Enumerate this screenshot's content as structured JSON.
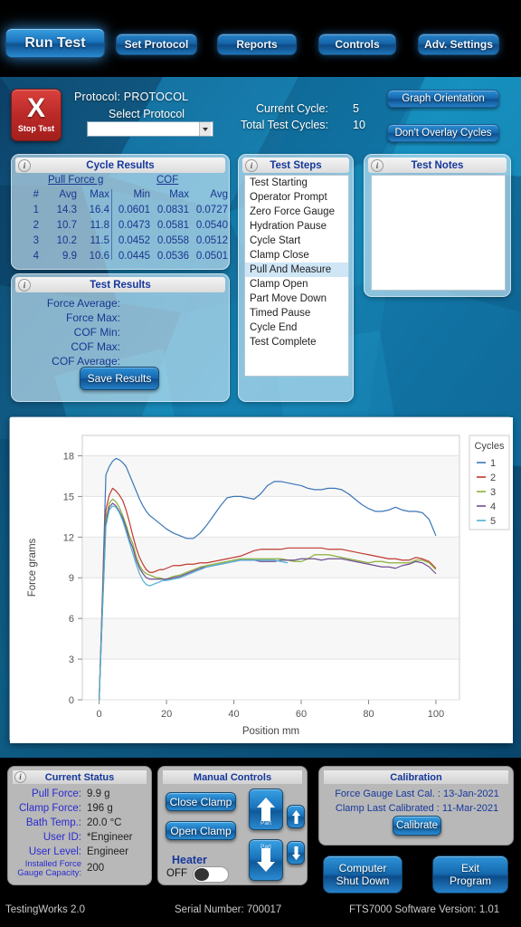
{
  "topnav": {
    "items": [
      {
        "label": "Run Test",
        "active": true
      },
      {
        "label": "Set Protocol",
        "active": false
      },
      {
        "label": "Reports",
        "active": false
      },
      {
        "label": "Controls",
        "active": false
      },
      {
        "label": "Adv. Settings",
        "active": false
      }
    ]
  },
  "header": {
    "stop_button": {
      "glyph": "X",
      "label": "Stop Test"
    },
    "protocol_label": "Protocol: PROTOCOL",
    "select_protocol_label": "Select Protocol",
    "protocol_select_value": "",
    "current_cycle_label": "Current Cycle:",
    "current_cycle_value": "5",
    "total_cycles_label": "Total Test Cycles:",
    "total_cycles_value": "10",
    "graph_orientation_button": "Graph Orientation",
    "overlay_cycles_button": "Don't Overlay Cycles"
  },
  "cycle_results": {
    "title": "Cycle Results",
    "group_headers": [
      "Pull Force g",
      "COF"
    ],
    "columns": [
      "#",
      "Avg",
      "Max",
      "Min",
      "Max",
      "Avg"
    ],
    "rows": [
      [
        "1",
        "14.3",
        "16.4",
        "0.0601",
        "0.0831",
        "0.0727"
      ],
      [
        "2",
        "10.7",
        "11.8",
        "0.0473",
        "0.0581",
        "0.0540"
      ],
      [
        "3",
        "10.2",
        "11.5",
        "0.0452",
        "0.0558",
        "0.0512"
      ],
      [
        "4",
        "9.9",
        "10.6",
        "0.0445",
        "0.0536",
        "0.0501"
      ]
    ]
  },
  "test_results": {
    "title": "Test Results",
    "lines": [
      {
        "label": "Force Average:",
        "value": ""
      },
      {
        "label": "Force Max:",
        "value": ""
      },
      {
        "label": "COF Min:",
        "value": ""
      },
      {
        "label": "COF Max:",
        "value": ""
      },
      {
        "label": "COF Average:",
        "value": ""
      }
    ],
    "save_button": "Save Results"
  },
  "test_steps": {
    "title": "Test Steps",
    "selected": "Pull And Measure",
    "items": [
      "Test Starting",
      "Operator Prompt",
      "Zero Force Gauge",
      "Hydration  Pause",
      "Cycle Start",
      "Clamp Close",
      "Pull And Measure",
      "Clamp Open",
      "Part Move Down",
      "Timed  Pause",
      "Cycle End",
      "Test Complete"
    ]
  },
  "test_notes": {
    "title": "Test Notes",
    "value": ""
  },
  "chart_data": {
    "type": "line",
    "title": "",
    "xlabel": "Position mm",
    "ylabel": "Force grams",
    "xlim": [
      -5,
      107
    ],
    "ylim": [
      0,
      19.5
    ],
    "xticks": [
      0,
      20,
      40,
      60,
      80,
      100
    ],
    "yticks": [
      0,
      3,
      6,
      9,
      12,
      15,
      18
    ],
    "grid": true,
    "legend_title": "Cycles",
    "legend_position": "right",
    "series": [
      {
        "name": "1",
        "color": "#3a76b8",
        "x": [
          0,
          1,
          2,
          3,
          4,
          5,
          6,
          7,
          8,
          9,
          10,
          11,
          12,
          13,
          14,
          15,
          16,
          17,
          18,
          19,
          20,
          22,
          24,
          26,
          28,
          30,
          32,
          34,
          36,
          38,
          40,
          42,
          44,
          46,
          48,
          50,
          52,
          54,
          56,
          58,
          60,
          62,
          64,
          66,
          68,
          70,
          72,
          74,
          76,
          78,
          80,
          82,
          84,
          86,
          88,
          90,
          92,
          94,
          96,
          98,
          100
        ],
        "y": [
          0,
          8.0,
          16.6,
          17.2,
          17.6,
          17.8,
          17.7,
          17.5,
          17.2,
          16.6,
          16.0,
          15.4,
          14.8,
          14.3,
          13.9,
          13.6,
          13.4,
          13.2,
          13.0,
          12.8,
          12.6,
          12.3,
          12.1,
          11.9,
          11.9,
          12.3,
          12.9,
          13.6,
          14.3,
          14.9,
          15.0,
          15.0,
          14.9,
          14.8,
          15.2,
          15.8,
          16.1,
          16.1,
          16.0,
          15.9,
          15.8,
          15.6,
          15.5,
          15.5,
          15.6,
          15.6,
          15.5,
          15.2,
          14.8,
          14.4,
          14.1,
          13.9,
          13.9,
          14.0,
          14.2,
          14.0,
          13.9,
          13.9,
          13.8,
          13.3,
          12.1
        ]
      },
      {
        "name": "2",
        "color": "#c0392f",
        "x": [
          0,
          1,
          2,
          3,
          4,
          5,
          6,
          7,
          8,
          9,
          10,
          11,
          12,
          13,
          14,
          15,
          16,
          17,
          18,
          19,
          20,
          22,
          24,
          26,
          28,
          30,
          32,
          34,
          36,
          38,
          40,
          42,
          44,
          46,
          48,
          50,
          52,
          54,
          56,
          58,
          60,
          62,
          64,
          66,
          68,
          70,
          72,
          74,
          76,
          78,
          80,
          82,
          84,
          86,
          88,
          90,
          92,
          94,
          96,
          98,
          100
        ],
        "y": [
          0,
          7.5,
          14.0,
          15.1,
          15.6,
          15.4,
          15.1,
          14.7,
          14.0,
          13.1,
          12.1,
          11.2,
          10.5,
          10.0,
          9.6,
          9.4,
          9.4,
          9.5,
          9.6,
          9.6,
          9.7,
          9.9,
          9.9,
          10.0,
          10.0,
          10.1,
          10.1,
          10.2,
          10.3,
          10.4,
          10.5,
          10.6,
          10.8,
          11.0,
          11.1,
          11.1,
          11.1,
          11.1,
          11.2,
          11.2,
          11.2,
          11.2,
          11.2,
          11.2,
          11.1,
          11.1,
          11.1,
          11.0,
          10.9,
          10.8,
          10.7,
          10.6,
          10.5,
          10.4,
          10.4,
          10.3,
          10.3,
          10.5,
          10.4,
          10.2,
          9.7
        ]
      },
      {
        "name": "3",
        "color": "#8aae3c",
        "x": [
          0,
          1,
          2,
          3,
          4,
          5,
          6,
          7,
          8,
          9,
          10,
          11,
          12,
          13,
          14,
          15,
          16,
          17,
          18,
          19,
          20,
          22,
          24,
          26,
          28,
          30,
          32,
          34,
          36,
          38,
          40,
          42,
          44,
          46,
          48,
          50,
          52,
          54,
          56,
          58,
          60,
          62,
          64,
          66,
          68,
          70,
          72,
          74,
          76,
          78,
          80,
          82,
          84,
          86,
          88,
          90,
          92,
          94,
          96,
          98,
          100
        ],
        "y": [
          0,
          7.0,
          13.3,
          14.5,
          14.8,
          14.6,
          14.2,
          13.6,
          12.9,
          12.1,
          11.5,
          10.6,
          9.9,
          9.5,
          9.3,
          9.2,
          9.1,
          9.0,
          9.0,
          8.9,
          8.9,
          9.1,
          9.2,
          9.4,
          9.6,
          9.8,
          9.9,
          10.0,
          10.1,
          10.2,
          10.3,
          10.4,
          10.4,
          10.4,
          10.4,
          10.4,
          10.4,
          10.4,
          10.3,
          10.2,
          10.2,
          10.4,
          10.7,
          10.7,
          10.7,
          10.6,
          10.5,
          10.4,
          10.3,
          10.2,
          10.1,
          10.2,
          10.2,
          10.1,
          10.1,
          10.1,
          10.1,
          10.3,
          10.3,
          10.1,
          9.6
        ]
      },
      {
        "name": "4",
        "color": "#6f4e8e",
        "x": [
          0,
          1,
          2,
          3,
          4,
          5,
          6,
          7,
          8,
          9,
          10,
          11,
          12,
          13,
          14,
          15,
          16,
          17,
          18,
          19,
          20,
          22,
          24,
          26,
          28,
          30,
          32,
          34,
          36,
          38,
          40,
          42,
          44,
          46,
          48,
          50,
          52,
          54,
          56,
          58,
          60,
          62,
          64,
          66,
          68,
          70,
          72,
          74,
          76,
          78,
          80,
          82,
          84,
          86,
          88,
          90,
          92,
          94,
          96,
          98,
          100
        ],
        "y": [
          0,
          6.8,
          13.0,
          14.2,
          14.5,
          14.3,
          13.9,
          13.4,
          12.7,
          11.8,
          11.2,
          10.3,
          9.7,
          9.3,
          9.0,
          8.9,
          8.9,
          8.9,
          8.9,
          8.9,
          8.9,
          9.0,
          9.1,
          9.3,
          9.5,
          9.7,
          9.8,
          9.9,
          10.0,
          10.1,
          10.2,
          10.3,
          10.3,
          10.3,
          10.2,
          10.2,
          10.2,
          10.3,
          10.3,
          10.3,
          10.4,
          10.4,
          10.4,
          10.3,
          10.4,
          10.4,
          10.4,
          10.3,
          10.2,
          10.1,
          10.0,
          9.9,
          9.8,
          9.8,
          9.7,
          9.9,
          10.0,
          10.2,
          10.1,
          9.8,
          9.3
        ]
      },
      {
        "name": "5",
        "color": "#4fb0d6",
        "x": [
          0,
          1,
          2,
          3,
          4,
          5,
          6,
          7,
          8,
          9,
          10,
          11,
          12,
          13,
          14,
          15,
          16,
          17,
          18,
          19,
          20,
          22,
          24,
          26,
          28,
          30,
          32,
          34,
          36,
          38,
          40,
          42,
          44,
          46,
          48,
          50,
          52,
          54,
          56
        ],
        "y": [
          0,
          6.5,
          12.8,
          14.0,
          14.3,
          14.2,
          13.8,
          13.2,
          12.4,
          11.6,
          10.8,
          10.0,
          9.3,
          8.8,
          8.5,
          8.4,
          8.5,
          8.6,
          8.7,
          8.8,
          8.8,
          8.9,
          9.0,
          9.2,
          9.4,
          9.6,
          9.8,
          9.9,
          10.0,
          10.1,
          10.2,
          10.3,
          10.3,
          10.3,
          10.3,
          10.3,
          10.3,
          10.2,
          10.1
        ]
      }
    ]
  },
  "current_status": {
    "title": "Current Status",
    "rows": [
      {
        "label": "Pull Force:",
        "value": "9.9 g"
      },
      {
        "label": "Clamp Force:",
        "value": "196 g"
      },
      {
        "label": "Bath Temp.:",
        "value": "20.0 °C"
      },
      {
        "label": "User ID:",
        "value": "*Engineer"
      },
      {
        "label": "User Level:",
        "value": "Engineer"
      }
    ],
    "gauge_label_line1": "Installed Force",
    "gauge_label_line2": "Gauge Capacity:",
    "gauge_value": "200"
  },
  "manual_controls": {
    "title": "Manual Controls",
    "close_clamp": "Close Clamp",
    "open_clamp": "Open Clamp",
    "heater_label": "Heater",
    "heater_state": "OFF",
    "part_up_label": "Part",
    "part_down_label": "Part"
  },
  "calibration": {
    "title": "Calibration",
    "force_gauge_line": "Force Gauge Last Cal. : 13-Jan-2021",
    "clamp_line": "Clamp Last Calibrated : 11-Mar-2021",
    "calibrate_button": "Calibrate"
  },
  "power": {
    "shutdown_line1": "Computer",
    "shutdown_line2": "Shut Down",
    "exit_line1": "Exit",
    "exit_line2": "Program"
  },
  "footer": {
    "app": "TestingWorks 2.0",
    "serial": "Serial Number: 700017",
    "version": "FTS7000 Software Version: 1.01"
  }
}
